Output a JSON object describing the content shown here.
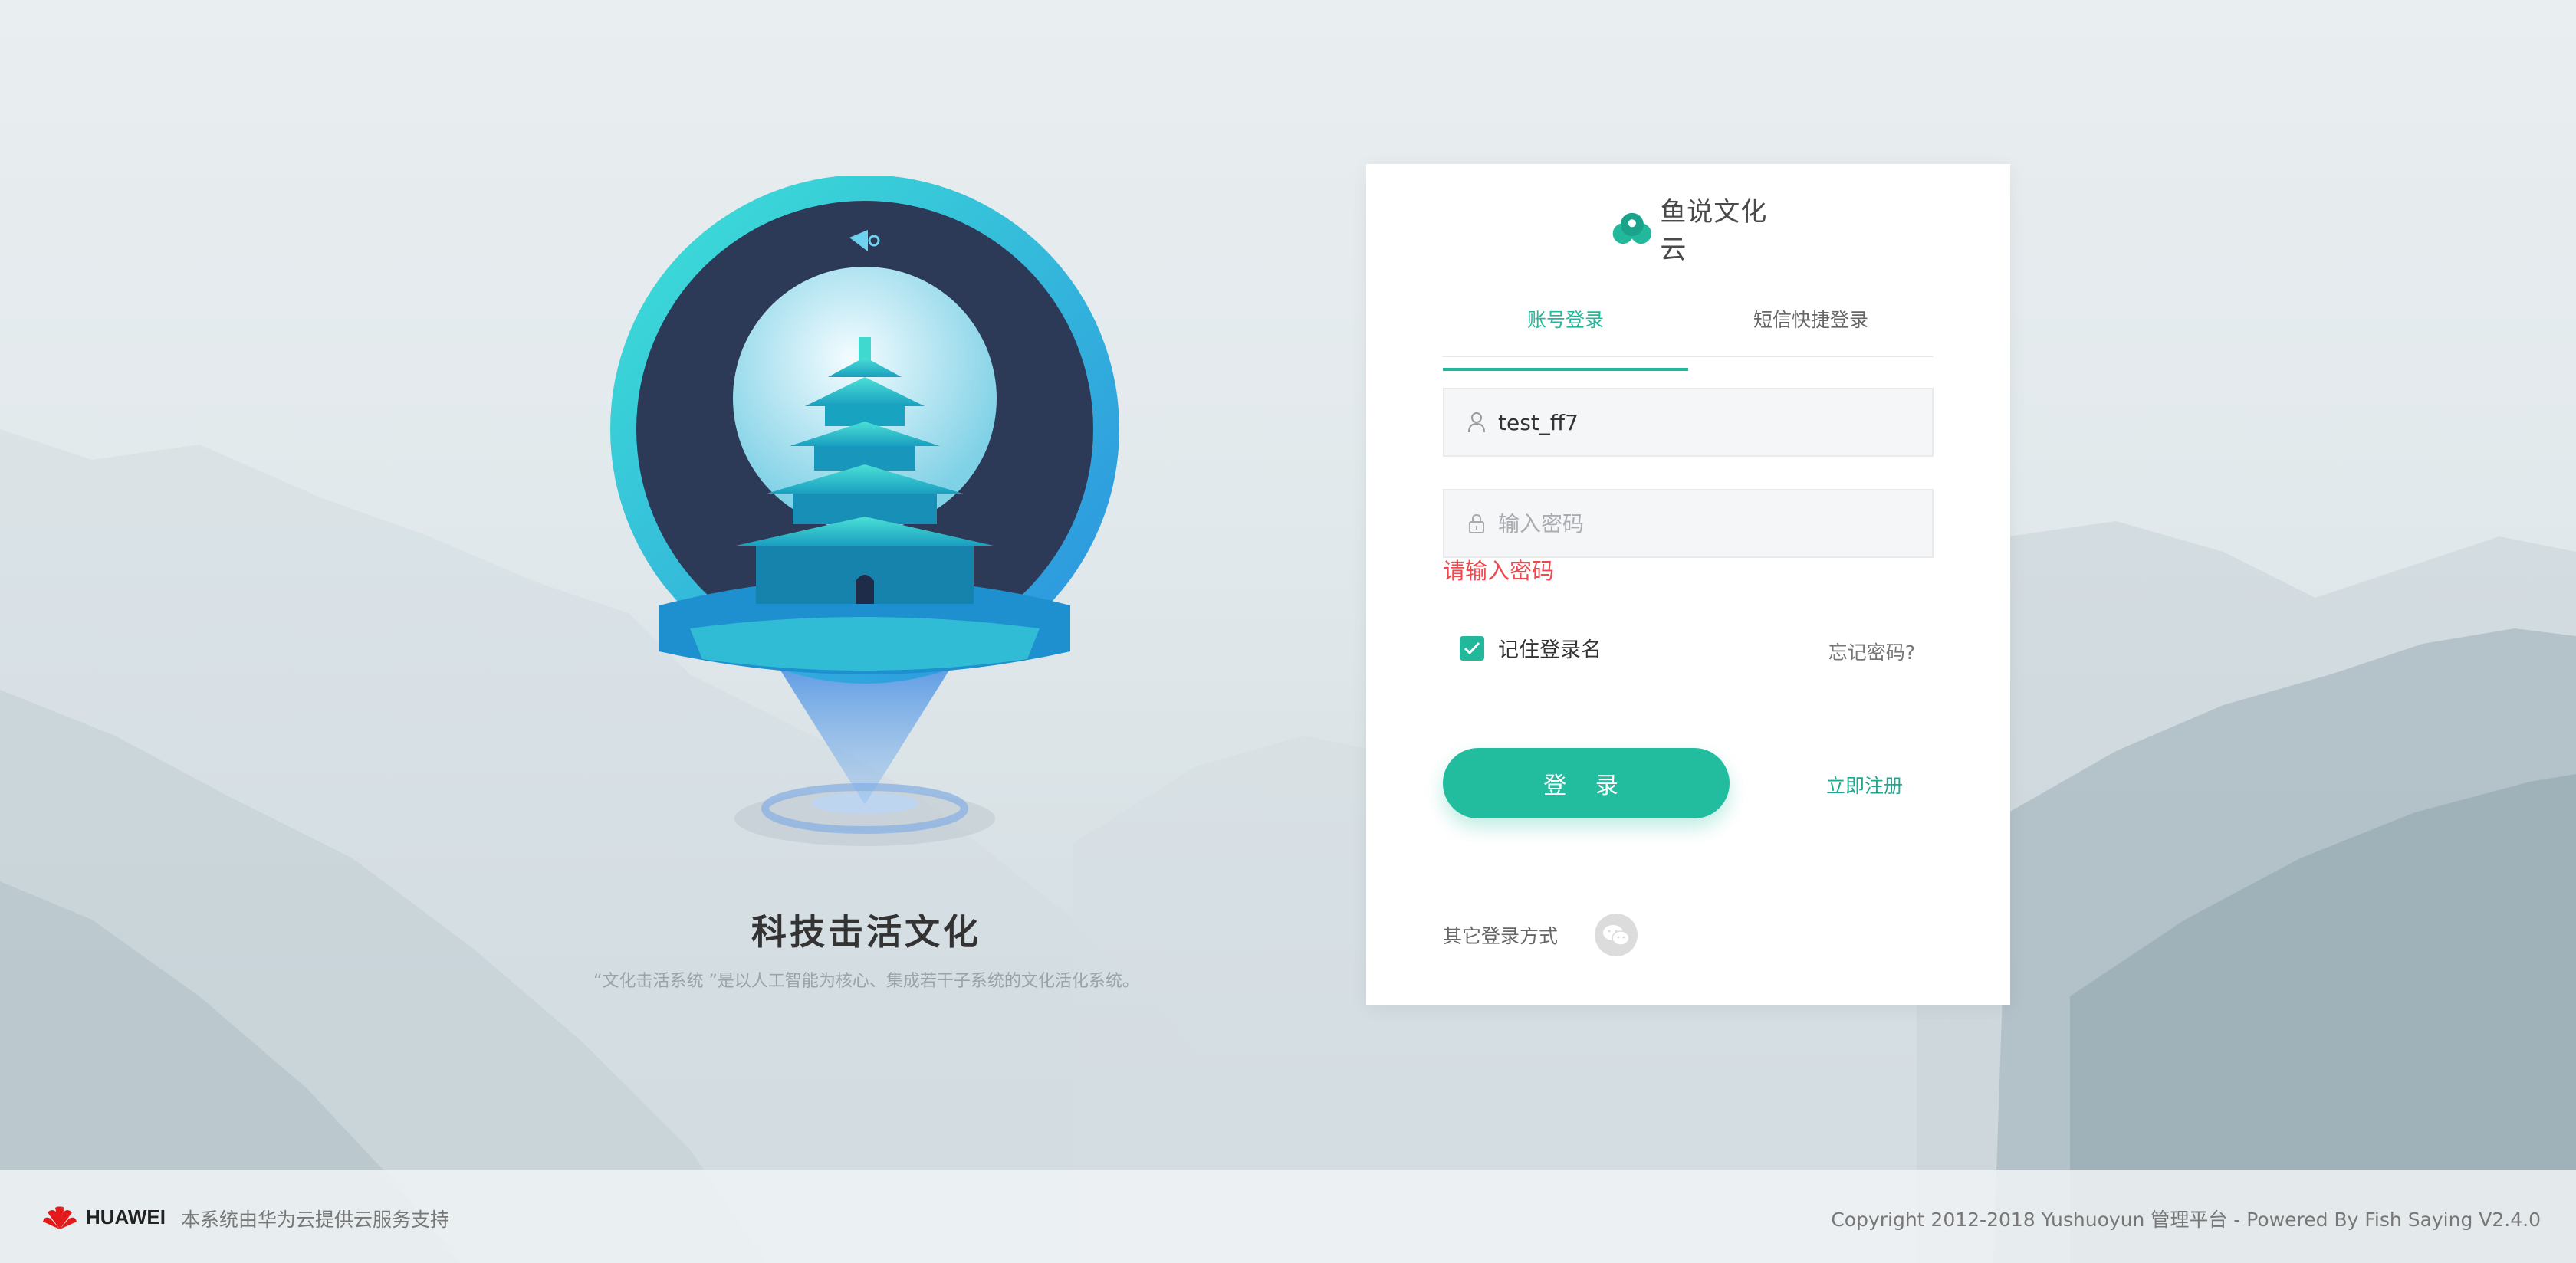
{
  "hero": {
    "slogan": "科技击活文化",
    "subtitle": "“文化击活系统 ”是以人工智能为核心、集成若干子系统的文化活化系统。"
  },
  "brand": {
    "logo_text": "鱼说文化云"
  },
  "tabs": [
    {
      "label": "账号登录",
      "active": true
    },
    {
      "label": "短信快捷登录",
      "active": false
    }
  ],
  "form": {
    "username_value": "test_ff7",
    "password_placeholder": "输入密码",
    "password_error": "请输入密码",
    "remember_label": "记住登录名",
    "remember_checked": true,
    "forgot_label": "忘记密码?",
    "login_label": "登 录",
    "register_label": "立即注册",
    "other_login_label": "其它登录方式"
  },
  "footer": {
    "brand": "HUAWEI",
    "support_text": "本系统由华为云提供云服务支持",
    "copyright": "Copyright 2012-2018 Yushuoyun 管理平台 - Powered By Fish Saying V2.4.0"
  },
  "colors": {
    "accent": "#22b89c",
    "error": "#f0484f"
  }
}
